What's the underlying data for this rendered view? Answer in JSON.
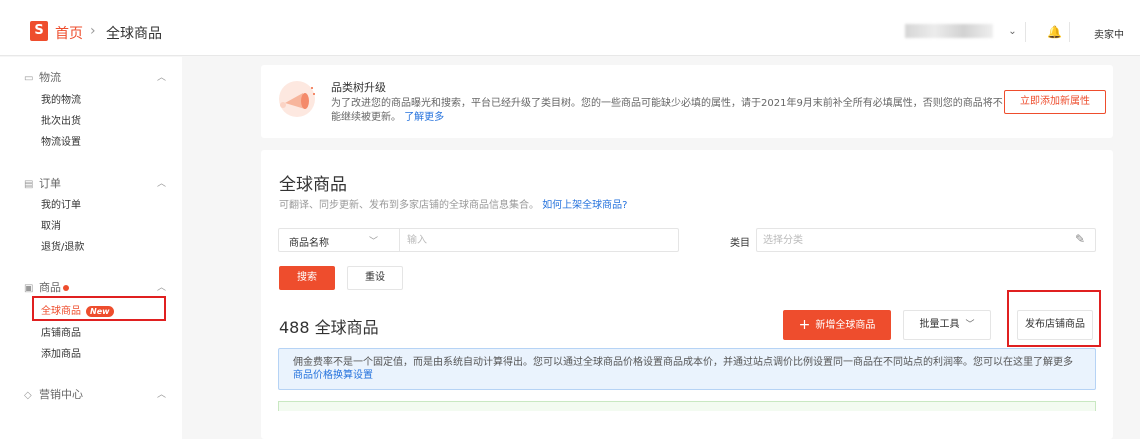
{
  "header": {
    "logo_letter": "S",
    "breadcrumb_home": "首页",
    "breadcrumb_separator": "›",
    "breadcrumb_current": "全球商品",
    "seller_label": "卖家中"
  },
  "sidebar": {
    "sections": [
      {
        "title": "物流",
        "items": [
          "我的物流",
          "批次出货",
          "物流设置"
        ]
      },
      {
        "title": "订单",
        "items": [
          "我的订单",
          "取消",
          "退货/退款"
        ]
      },
      {
        "title": "商品",
        "items": [
          "全球商品",
          "店铺商品",
          "添加商品"
        ]
      },
      {
        "title": "营销中心",
        "items": []
      }
    ],
    "active_badge": "New"
  },
  "notice": {
    "title": "品类树升级",
    "description": "为了改进您的商品曝光和搜索，平台已经升级了类目树。您的一些商品可能缺少必填的属性，请于2021年9月末前补全所有必填属性，否则您的商品将不能继续被更新。",
    "learn_more": "了解更多",
    "button": "立即添加新属性"
  },
  "main": {
    "title": "全球商品",
    "subtitle": "可翻译、同步更新、发布到多家店铺的全球商品信息集合。",
    "subtitle_link": "如何上架全球商品?",
    "filter_select": "商品名称",
    "filter_placeholder": "输入",
    "category_label": "类目",
    "category_placeholder": "选择分类",
    "search_button": "搜索",
    "reset_button": "重设",
    "count_text": "488 全球商品",
    "add_button": "新增全球商品",
    "bulk_button": "批量工具",
    "publish_button": "发布店铺商品",
    "info_text": "佣金费率不是一个固定值，而是由系统自动计算得出。您可以通过全球商品价格设置商品成本价，并通过站点调价比例设置同一商品在不同站点的利润率。您可以在这里了解更多",
    "info_link": "商品价格换算设置"
  },
  "colors": {
    "brand": "#ee4d2d",
    "link": "#2673dd",
    "highlight_box": "#e02020"
  }
}
